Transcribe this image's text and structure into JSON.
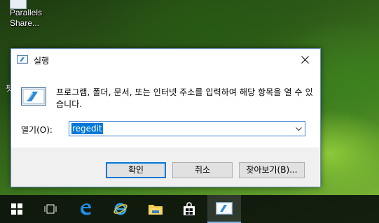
{
  "desktop": {
    "icon_label_line1": "Parallels",
    "icon_label_line2": "Share...",
    "partial_label": "핏"
  },
  "dialog": {
    "title": "실행",
    "description": "프로그램, 폴더, 문서, 또는 인터넷 주소를 입력하여 해당 항목을 열 수 있습니다.",
    "open_label": "열기(O):",
    "input_value": "regedit",
    "buttons": {
      "ok": "확인",
      "cancel": "취소",
      "browse": "찾아보기(B)..."
    }
  },
  "taskbar": {
    "items": [
      {
        "icon": "start-windows-icon"
      },
      {
        "icon": "task-view-icon"
      },
      {
        "icon": "edge-browser-icon"
      },
      {
        "icon": "internet-explorer-icon"
      },
      {
        "icon": "file-explorer-icon"
      },
      {
        "icon": "store-icon"
      },
      {
        "icon": "run-dialog-icon",
        "active": true
      }
    ]
  },
  "colors": {
    "accent": "#0078d7",
    "dialog_border": "#6e94c8"
  }
}
